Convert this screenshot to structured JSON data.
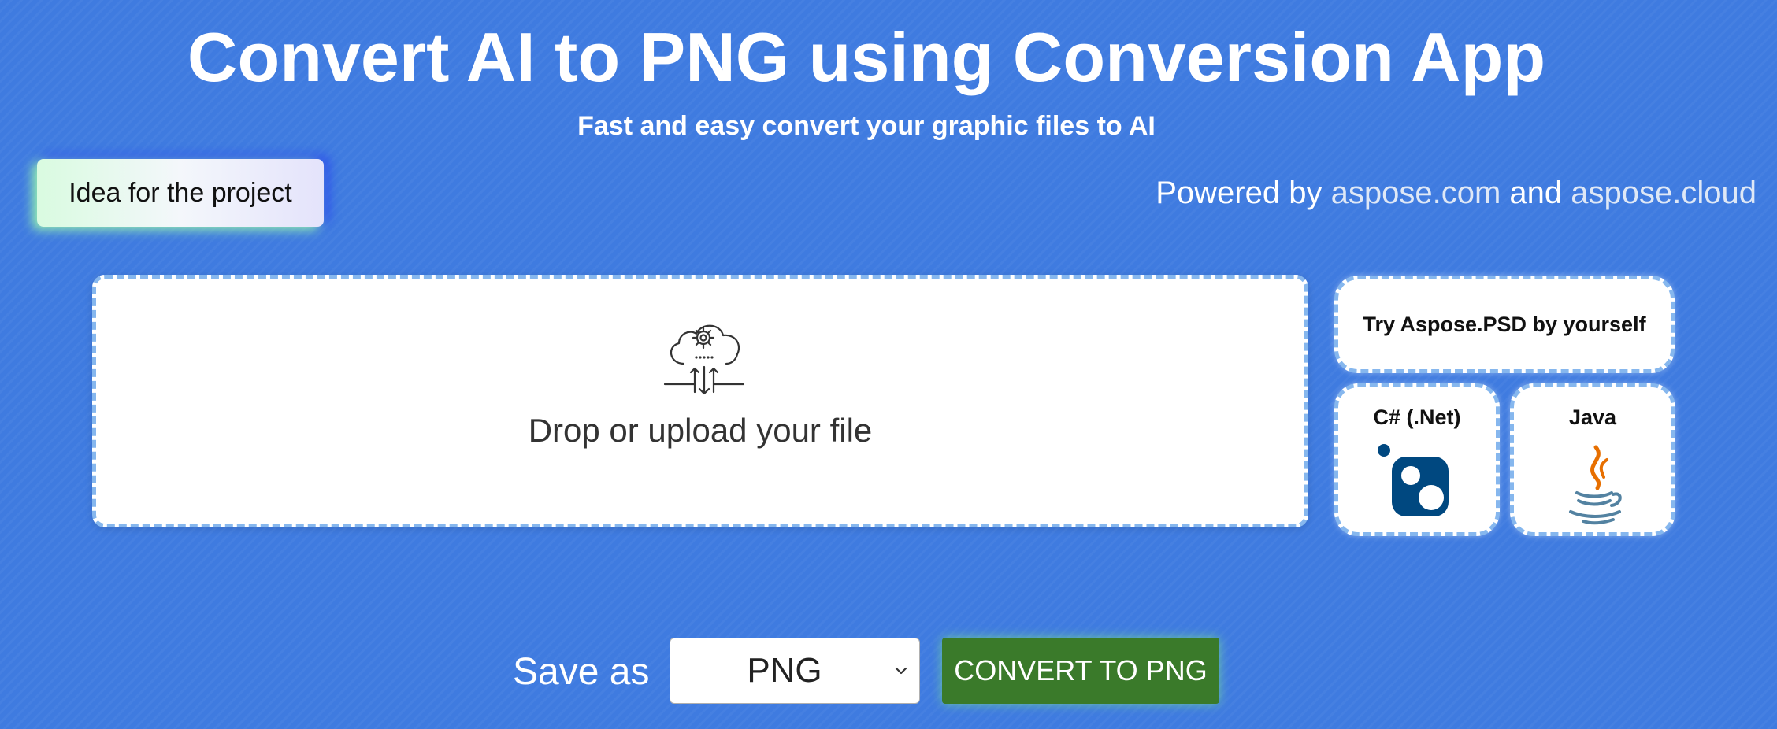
{
  "header": {
    "title": "Convert AI to PNG using Conversion App",
    "subtitle": "Fast and easy convert your graphic files to AI"
  },
  "idea_button": {
    "label": "Idea for the project"
  },
  "powered": {
    "prefix": "Powered by",
    "link1": "aspose.com",
    "conjunction": "and",
    "link2": "aspose.cloud"
  },
  "dropzone": {
    "icon": "cloud-upload-gear-icon",
    "text": "Drop or upload your file"
  },
  "try_panel": {
    "label": "Try Aspose.PSD by yourself",
    "csharp": {
      "label": "C# (.Net)",
      "icon": "nuget-icon"
    },
    "java": {
      "label": "Java",
      "icon": "java-icon"
    }
  },
  "save": {
    "label": "Save as",
    "selected": "PNG",
    "icon": "chevron-down-icon"
  },
  "convert_button": {
    "label": "CONVERT TO PNG"
  },
  "colors": {
    "background": "#3f7be0",
    "convert_button": "#3a7a2a",
    "dashed_border": "#86b7ee",
    "nuget_blue": "#004880",
    "java_orange": "#e76f00",
    "java_blue": "#5382a1"
  }
}
